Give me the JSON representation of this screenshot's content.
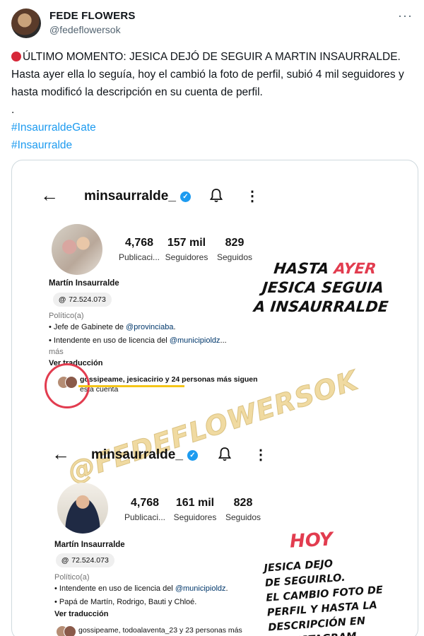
{
  "tweet": {
    "display_name": "FEDE FLOWERS",
    "handle": "@fedeflowersok",
    "more_icon": "more-options-icon",
    "text_line1": "ÚLTIMO MOMENTO: JESICA DEJÓ DE SEGUIR A MARTIN INSAURRALDE.",
    "text_line2": "Hasta ayer ella lo seguía,  hoy el cambió la foto de perfil, subió 4 mil seguidores y hasta modificó la descripción en su cuenta de perfil.",
    "dot_line": ".",
    "hashtags": [
      "#InsaurraldeGate",
      "#Insaurralde"
    ]
  },
  "media": {
    "before": {
      "username": "minsaurralde_",
      "stats": [
        {
          "value": "4,768",
          "label": "Publicaci..."
        },
        {
          "value": "157 mil",
          "label": "Seguidores"
        },
        {
          "value": "829",
          "label": "Seguidos"
        }
      ],
      "name": "Martín Insaurralde",
      "threads": "72.524.073",
      "category": "Político(a)",
      "bio_line1_prefix": "• Jefe de Gabinete de ",
      "bio_line1_mention": "@provinciaba",
      "bio_line1_suffix": ".",
      "bio_line2_prefix": "• Intendente en uso de licencia del ",
      "bio_line2_mention": "@municipioldz",
      "bio_line2_suffix": "...",
      "more": "más",
      "translate": "Ver traducción",
      "followed_by": "gossipeame, jesicacirio y 24 personas más siguen",
      "followed_by2": "esta cuenta"
    },
    "after": {
      "username": "minsaurralde_",
      "stats": [
        {
          "value": "4,768",
          "label": "Publicaci..."
        },
        {
          "value": "161 mil",
          "label": "Seguidores"
        },
        {
          "value": "828",
          "label": "Seguidos"
        }
      ],
      "name": "Martín Insaurralde",
      "threads": "72.524.073",
      "category": "Político(a)",
      "bio_line1_prefix": "• Intendente en uso de licencia del ",
      "bio_line1_mention": "@municipioldz",
      "bio_line1_suffix": ".",
      "bio_line2": "• Papá de Martín, Rodrigo, Bauti y Chloé.",
      "translate": "Ver traducción",
      "followed_by": "gossipeame, todoalaventa_23 y 23 personas más"
    },
    "caption_before": {
      "line1_a": "HASTA ",
      "line1_b": "AYER",
      "line2": "JESICA SEGUIA",
      "line3": "A  INSAURRALDE"
    },
    "caption_hoy": "HOY",
    "caption_after": [
      "JESICA DEJO",
      "DE SEGUIRLO.",
      "EL CAMBIO FOTO DE",
      "PERFIL Y HASTA LA",
      "DESCRIPCIÓN EN",
      "SU INSTAGRAM"
    ],
    "watermark": "@FEDEFLOWERSOK"
  },
  "colors": {
    "accent_red": "#e23c4f",
    "link_blue": "#1d9bf0",
    "verified_blue": "#1d9bf0",
    "highlight_yellow": "#f5c518"
  }
}
